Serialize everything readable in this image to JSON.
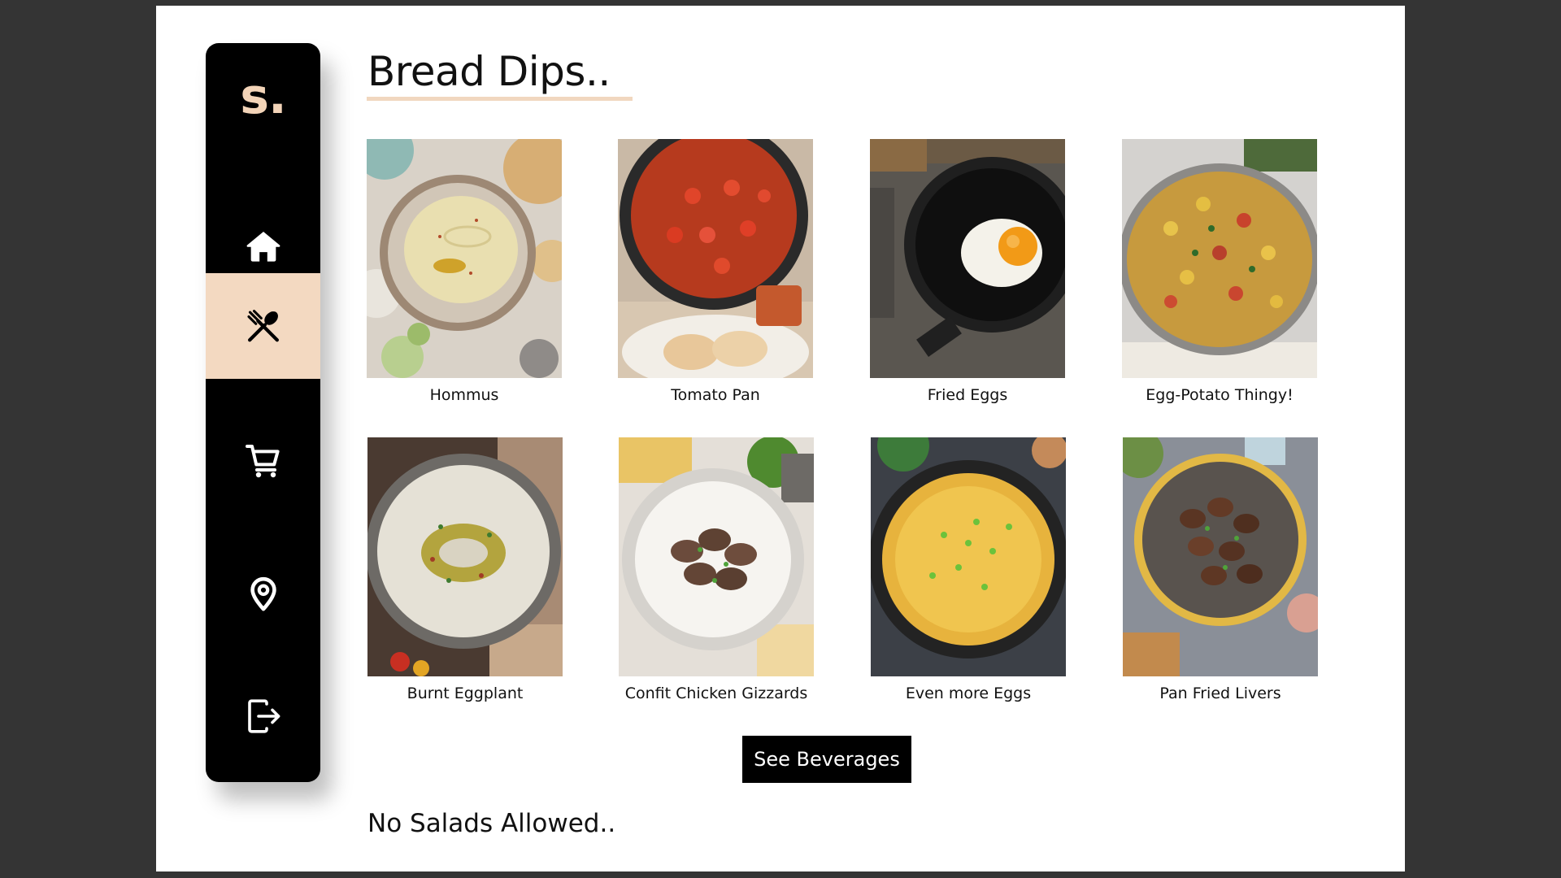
{
  "sidebar": {
    "logo": "s.",
    "items": [
      {
        "icon": "home-icon",
        "active": false
      },
      {
        "icon": "utensils-icon",
        "active": true
      },
      {
        "icon": "cart-icon",
        "active": false
      },
      {
        "icon": "location-pin-icon",
        "active": false
      },
      {
        "icon": "logout-icon",
        "active": false
      }
    ]
  },
  "colors": {
    "page_background": "#343434",
    "accent": "#f3d9c1",
    "sidebar": "#000000",
    "button": "#000000"
  },
  "main": {
    "title": "Bread Dips..",
    "dishes": [
      {
        "name": "Hommus"
      },
      {
        "name": "Tomato Pan"
      },
      {
        "name": "Fried Eggs"
      },
      {
        "name": "Egg-Potato Thingy!"
      },
      {
        "name": "Burnt Eggplant"
      },
      {
        "name": "Confit Chicken Gizzards"
      },
      {
        "name": "Even more Eggs"
      },
      {
        "name": "Pan Fried Livers"
      }
    ],
    "cta_label": "See Beverages",
    "footer_note": "No Salads Allowed.."
  }
}
